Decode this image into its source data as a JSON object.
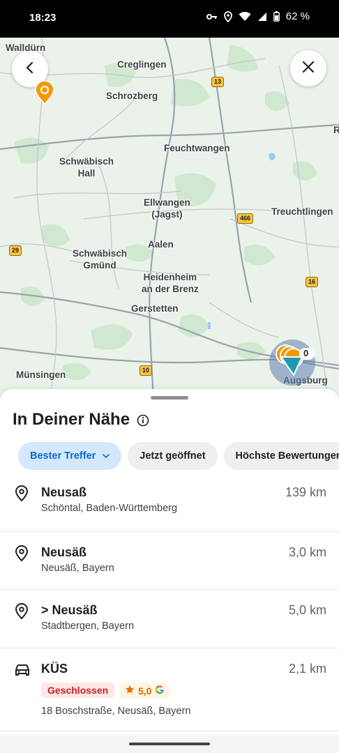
{
  "status": {
    "time": "18:23",
    "battery": "62 %"
  },
  "map": {
    "cities": [
      {
        "name": "Walldürn"
      },
      {
        "name": "Creglingen"
      },
      {
        "name": "Schrozberg"
      },
      {
        "name": "Feuchtwangen"
      },
      {
        "name": "Schwäbisch\nHall"
      },
      {
        "name": "Ellwangen\n(Jagst)"
      },
      {
        "name": "Treuchtlingen"
      },
      {
        "name": "Aalen"
      },
      {
        "name": "Schwäbisch\nGmünd"
      },
      {
        "name": "Heidenheim\nan der Brenz"
      },
      {
        "name": "Gerstetten"
      },
      {
        "name": "Münsingen"
      },
      {
        "name": "Augsburg"
      },
      {
        "name": "R"
      }
    ],
    "shields": [
      "13",
      "466",
      "29",
      "16",
      "10"
    ],
    "cluster_count_fragment": "0"
  },
  "sheet": {
    "title": "In Deiner Nähe",
    "chips": [
      {
        "label": "Bester Treffer"
      },
      {
        "label": "Jetzt geöffnet"
      },
      {
        "label": "Höchste Bewertungen"
      }
    ],
    "results": [
      {
        "name": "Neusaß",
        "address": "Schöntal, Baden-Württemberg",
        "distance": "139 km",
        "icon": "location-pin-icon"
      },
      {
        "name": "Neusäß",
        "address": "Neusäß, Bayern",
        "distance": "3,0 km",
        "icon": "location-pin-icon"
      },
      {
        "name": "> Neusäß",
        "address": "Stadtbergen, Bayern",
        "distance": "5,0 km",
        "icon": "location-pin-icon"
      },
      {
        "name": "KÜS",
        "status": "Geschlossen",
        "rating": "5,0",
        "address": "18 Boschstraße, Neusäß, Bayern",
        "distance": "2,1 km",
        "icon": "car-service-icon"
      }
    ]
  },
  "colors": {
    "accent": "#0b6bcb",
    "chip_active_bg": "#d3e8fb",
    "closed": "#c5221f",
    "pin": "#f29900"
  }
}
